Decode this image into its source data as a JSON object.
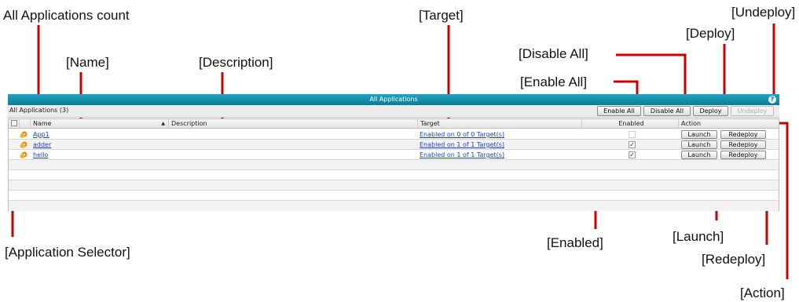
{
  "callouts": {
    "all_apps_count": "All Applications count",
    "name": "[Name]",
    "description": "[Description]",
    "target": "[Target]",
    "disable_all": "[Disable All]",
    "enable_all": "[Enable All]",
    "deploy": "[Deploy]",
    "undeploy": "[Undeploy]",
    "application_selector": "[Application Selector]",
    "enabled": "[Enabled]",
    "launch": "[Launch]",
    "redeploy": "[Redeploy]",
    "action": "[Action]"
  },
  "panel": {
    "title": "All Applications",
    "count_label": "All Applications (3)",
    "help_icon": "?"
  },
  "toolbar": {
    "enable_all": "Enable All",
    "disable_all": "Disable All",
    "deploy": "Deploy",
    "undeploy": "Undeploy"
  },
  "table": {
    "headers": {
      "name": "Name",
      "sort_indicator": "▲",
      "description": "Description",
      "target": "Target",
      "enabled": "Enabled",
      "action": "Action"
    },
    "rows": [
      {
        "name": "App1",
        "description": "",
        "target": "Enabled on 0 of 0 Target(s)",
        "enabled": false,
        "launch": "Launch",
        "redeploy": "Redeploy"
      },
      {
        "name": "adder",
        "description": "",
        "target": "Enabled on 1 of 1 Target(s)",
        "enabled": true,
        "launch": "Launch",
        "redeploy": "Redeploy"
      },
      {
        "name": "hello",
        "description": "",
        "target": "Enabled on 1 of 1 Target(s)",
        "enabled": true,
        "launch": "Launch",
        "redeploy": "Redeploy"
      }
    ]
  },
  "colors": {
    "titlebar": "#0a7c98",
    "callout_line": "#cc0000",
    "link": "#1a3fcf"
  },
  "icons": {
    "app_icon": "application-gear-icon",
    "help_icon": "help-icon",
    "checkbox_checked": "✓"
  }
}
